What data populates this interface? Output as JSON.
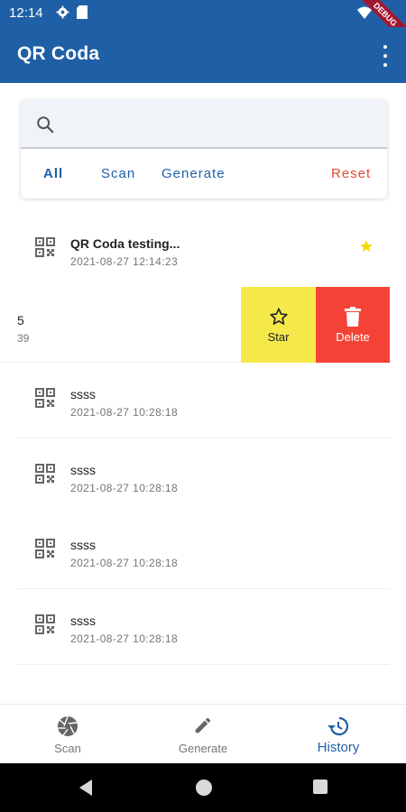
{
  "status_bar": {
    "time": "12:14",
    "debug_banner": "DEBUG"
  },
  "app_bar": {
    "title": "QR Coda"
  },
  "search": {
    "placeholder": ""
  },
  "filters": [
    {
      "label": "All",
      "active": true
    },
    {
      "label": "Scan",
      "active": false
    },
    {
      "label": "Generate",
      "active": false
    }
  ],
  "reset_label": "Reset",
  "history": [
    {
      "title": "QR Coda testing...",
      "date": "2021-08-27 12:14:23",
      "starred": true,
      "bold": true
    },
    {
      "title": "ssss",
      "date": "2021-08-27 10:28:18",
      "starred": false,
      "bold": false
    },
    {
      "title": "ssss",
      "date": "2021-08-27 10:28:18",
      "starred": false,
      "bold": false
    },
    {
      "title": "ssss",
      "date": "2021-08-27 10:28:18",
      "starred": false,
      "bold": false
    },
    {
      "title": "ssss",
      "date": "2021-08-27 10:28:18",
      "starred": false,
      "bold": false
    }
  ],
  "swiped_item": {
    "title_fragment": "5",
    "date_fragment": "39"
  },
  "swipe_actions": {
    "star_label": "Star",
    "delete_label": "Delete"
  },
  "bottom_nav": [
    {
      "label": "Scan",
      "icon": "camera-shutter-icon",
      "active": false
    },
    {
      "label": "Generate",
      "icon": "pencil-icon",
      "active": false
    },
    {
      "label": "History",
      "icon": "history-icon",
      "active": true
    }
  ],
  "colors": {
    "primary": "#1f5fa6",
    "reset": "#e04a2e",
    "star_action": "#f5e94a",
    "delete_action": "#f44336",
    "star_icon": "#f5d90a"
  }
}
